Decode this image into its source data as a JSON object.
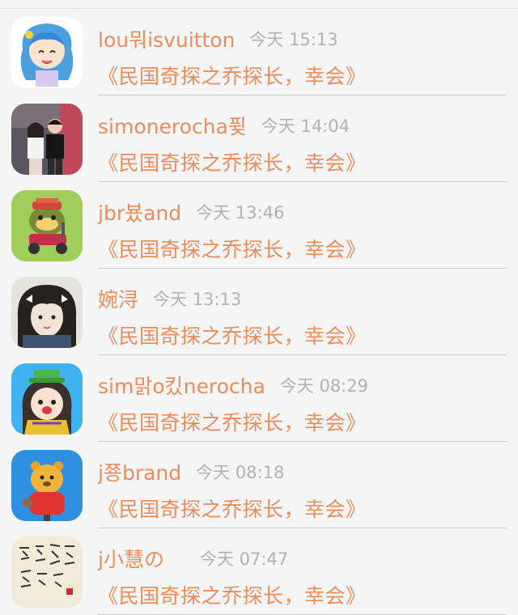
{
  "colors": {
    "accent": "#eb8d5b",
    "time": "#b2b2b4",
    "divider": "#c9c9cc",
    "background": "#f5f5f6"
  },
  "comments": [
    {
      "username": "lou뭐isvuitton",
      "time": "今天 15:13",
      "message": "《民国奇探之乔探长，幸会》",
      "avatar_icon": "anime-girl-blue-hair-avatar"
    },
    {
      "username": "simonerocha퓢",
      "time": "今天 14:04",
      "message": "《民国奇探之乔探长，幸会》",
      "avatar_icon": "couple-photo-avatar"
    },
    {
      "username": "jbr뵸and",
      "time": "今天 13:46",
      "message": "《民国奇探之乔探长，幸会》",
      "avatar_icon": "frog-on-scooter-avatar"
    },
    {
      "username": "婉浔",
      "time": "今天 13:13",
      "message": "《民国奇探之乔探长，幸会》",
      "avatar_icon": "girl-selfie-avatar"
    },
    {
      "username": "sim맑o킸nerocha",
      "time": "今天 08:29",
      "message": "《民国奇探之乔探长，幸会》",
      "avatar_icon": "cartoon-girl-green-hat-avatar"
    },
    {
      "username": "j쭁brand",
      "time": "今天 08:18",
      "message": "《民国奇探之乔探长，幸会》",
      "avatar_icon": "cartoon-bear-red-shirt-avatar"
    },
    {
      "username": "j小慧の",
      "time": "今天 07:47",
      "message": "《民国奇探之乔探长，幸会》",
      "avatar_icon": "calligraphy-scroll-avatar"
    }
  ]
}
